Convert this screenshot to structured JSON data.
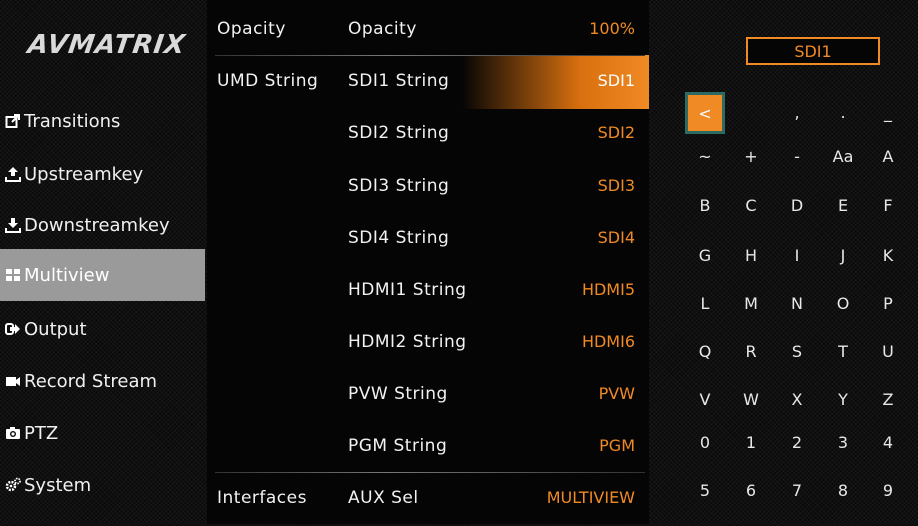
{
  "brand": {
    "logo": "AVMATRIX"
  },
  "sidebar": {
    "items": [
      {
        "label": "Transitions",
        "icon": "share-icon"
      },
      {
        "label": "Upstreamkey",
        "icon": "upload-icon"
      },
      {
        "label": "Downstreamkey",
        "icon": "download-icon"
      },
      {
        "label": "Multiview",
        "icon": "grid-icon",
        "active": true
      },
      {
        "label": "Output",
        "icon": "output-arrow-icon"
      },
      {
        "label": "Record Stream",
        "icon": "video-camera-icon"
      },
      {
        "label": "PTZ",
        "icon": "camera-icon"
      },
      {
        "label": "System",
        "icon": "gears-icon"
      }
    ]
  },
  "menu": {
    "rows": [
      {
        "group": "Opacity",
        "label": "Opacity",
        "value": "100%"
      },
      {
        "group": "UMD String",
        "label": "SDI1 String",
        "value": "SDI1",
        "selected": true
      },
      {
        "group": "",
        "label": "SDI2 String",
        "value": "SDI2"
      },
      {
        "group": "",
        "label": "SDI3 String",
        "value": "SDI3"
      },
      {
        "group": "",
        "label": "SDI4 String",
        "value": "SDI4"
      },
      {
        "group": "",
        "label": "HDMI1 String",
        "value": "HDMI5"
      },
      {
        "group": "",
        "label": "HDMI2 String",
        "value": "HDMI6"
      },
      {
        "group": "",
        "label": "PVW String",
        "value": "PVW"
      },
      {
        "group": "",
        "label": "PGM String",
        "value": "PGM"
      },
      {
        "group": "Interfaces",
        "label": "AUX Sel",
        "value": "MULTIVIEW"
      }
    ]
  },
  "keyboard": {
    "input_value": "SDI1",
    "rows": [
      [
        "<",
        "",
        ",",
        ".",
        "_"
      ],
      [
        "~",
        "+",
        "-",
        "Aa",
        "A"
      ],
      [
        "B",
        "C",
        "D",
        "E",
        "F"
      ],
      [
        "G",
        "H",
        "I",
        "J",
        "K"
      ],
      [
        "L",
        "M",
        "N",
        "O",
        "P"
      ],
      [
        "Q",
        "R",
        "S",
        "T",
        "U"
      ],
      [
        "V",
        "W",
        "X",
        "Y",
        "Z"
      ],
      [
        "0",
        "1",
        "2",
        "3",
        "4"
      ],
      [
        "5",
        "6",
        "7",
        "8",
        "9"
      ]
    ]
  },
  "colors": {
    "accent": "#f08a24",
    "active_nav": "#9a9a9a",
    "focus_border": "#2c6a62"
  }
}
